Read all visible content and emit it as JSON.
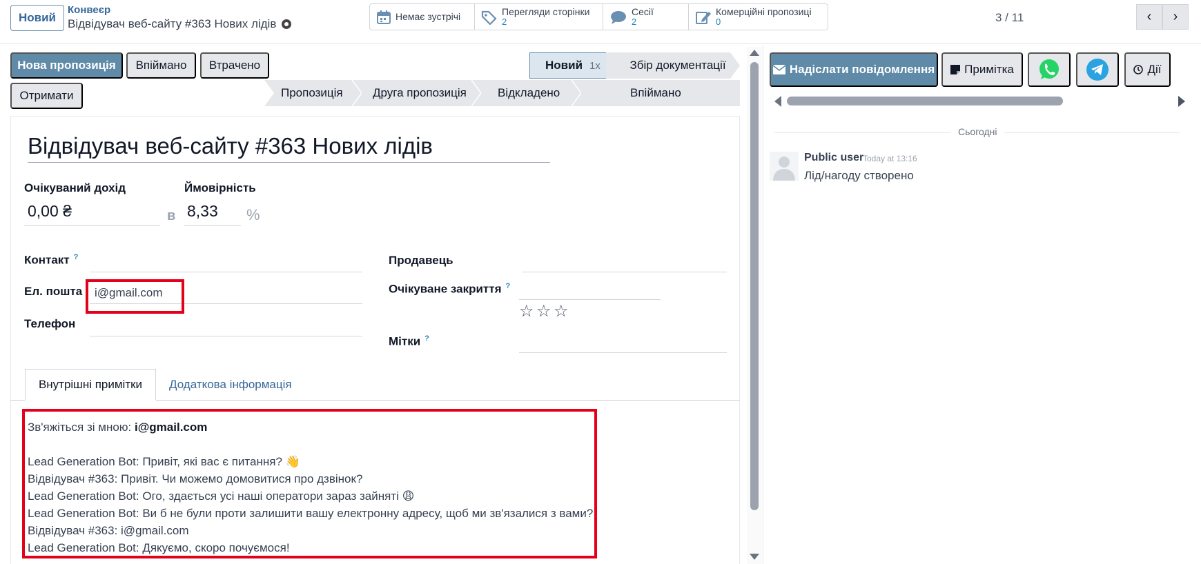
{
  "control_panel": {
    "new_button": "Новий",
    "breadcrumb_root": "Конвеєр",
    "record_title": "Відвідувач веб-сайту #363 Нових лідів",
    "stats": [
      {
        "label": "Немає зустрічі",
        "value": ""
      },
      {
        "label": "Перегляди сторінки",
        "value": "2"
      },
      {
        "label": "Сесії",
        "value": "2"
      },
      {
        "label": "Комерційні пропозиці",
        "value": "0"
      }
    ],
    "pager": "3 / 11"
  },
  "status_bar": {
    "buttons": [
      "Нова пропозиція",
      "Впіймано",
      "Втрачено",
      "Отримати"
    ],
    "stage_active": "Новий",
    "stage_active_count": "1x",
    "stage_next": "Збір документації",
    "stages_more": [
      "Пропозиція",
      "Друга пропозиція",
      "Відкладено",
      "Впіймано"
    ]
  },
  "form": {
    "title": "Відвідувач веб-сайту #363 Нових лідів",
    "expected_revenue_label": "Очікуваний дохід",
    "expected_revenue": "0,00 ₴",
    "at_label": "в",
    "probability_label": "Ймовірність",
    "probability": "8,33",
    "percent": "%",
    "contact_label": "Контакт",
    "help_mark": "?",
    "email_label": "Ел. пошта",
    "email": "i@gmail.com",
    "phone_label": "Телефон",
    "salesperson_label": "Продавець",
    "expected_closing_label": "Очікуване закриття",
    "tags_label": "Мітки",
    "priority_stars": 0
  },
  "tabs": [
    "Внутрішні примітки",
    "Додаткова інформація"
  ],
  "notes": {
    "contact_prefix": "Зв'яжіться зі мною: ",
    "contact_email": "i@gmail.com",
    "lines": [
      "Lead Generation Bot: Привіт, які вас є питання? 👋",
      "Відвідувач #363: Привіт. Чи можемо домовитися про дзвінок?",
      "Lead Generation Bot: Ого, здається усі наші оператори зараз зайняті 😩",
      "Lead Generation Bot: Ви б не були проти залишити вашу електронну адресу, щоб ми зв'язалися з вами?",
      "Відвідувач #363: i@gmail.com",
      "Lead Generation Bot: Дякуємо, скоро почуємося!"
    ]
  },
  "chatter": {
    "send_message": "Надіслати повідомлення",
    "note": "Примітка",
    "activities": "Дії",
    "today": "Сьогодні",
    "message": {
      "author": "Public user",
      "date": "Today at 13:16",
      "body": "Лід/нагоду створено"
    }
  },
  "colors": {
    "primary": "#5f8aa8",
    "link": "#35679a",
    "highlight_box": "#e3001b",
    "whatsapp": "#25d366",
    "telegram": "#2aa3e0"
  }
}
